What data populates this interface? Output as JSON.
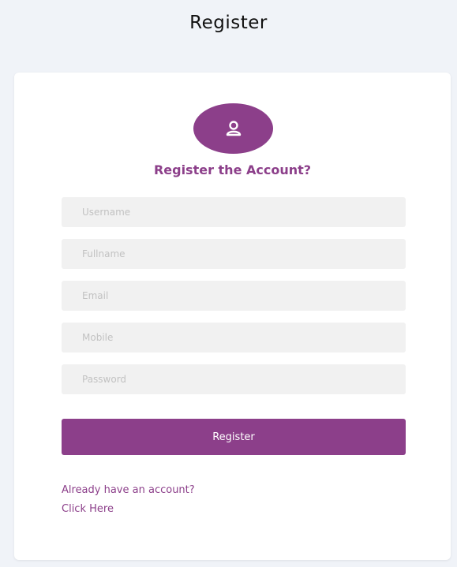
{
  "header": {
    "title": "Register"
  },
  "form": {
    "icon": "user-icon",
    "subtitle": "Register the Account?",
    "fields": [
      {
        "placeholder": "Username",
        "value": ""
      },
      {
        "placeholder": "Fullname",
        "value": ""
      },
      {
        "placeholder": "Email",
        "value": ""
      },
      {
        "placeholder": "Mobile",
        "value": ""
      },
      {
        "placeholder": "Password",
        "value": ""
      }
    ],
    "submit_label": "Register",
    "login_link": "Already have an account? Click Here"
  },
  "colors": {
    "accent": "#8c3f8a",
    "background": "#f0f3f8",
    "card": "#ffffff",
    "field": "#f1f1f1"
  }
}
